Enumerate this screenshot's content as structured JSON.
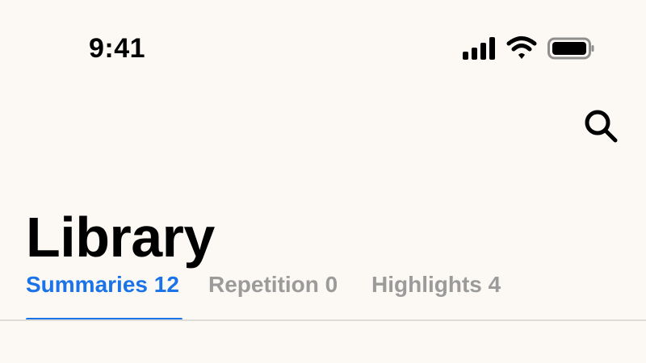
{
  "status_bar": {
    "time": "9:41",
    "signal_icon": "cellular-signal-icon",
    "wifi_icon": "wifi-icon",
    "battery_icon": "battery-icon"
  },
  "header": {
    "search_icon": "search-icon",
    "title": "Library"
  },
  "tabs": [
    {
      "label": "Summaries 12",
      "active": true
    },
    {
      "label": "Repetition 0",
      "active": false
    },
    {
      "label": "Highlights 4",
      "active": false
    }
  ],
  "colors": {
    "background": "#fcf8f3",
    "accent": "#1a73e8",
    "inactive_tab": "#9b9b9b",
    "divider": "#dedcd8"
  }
}
